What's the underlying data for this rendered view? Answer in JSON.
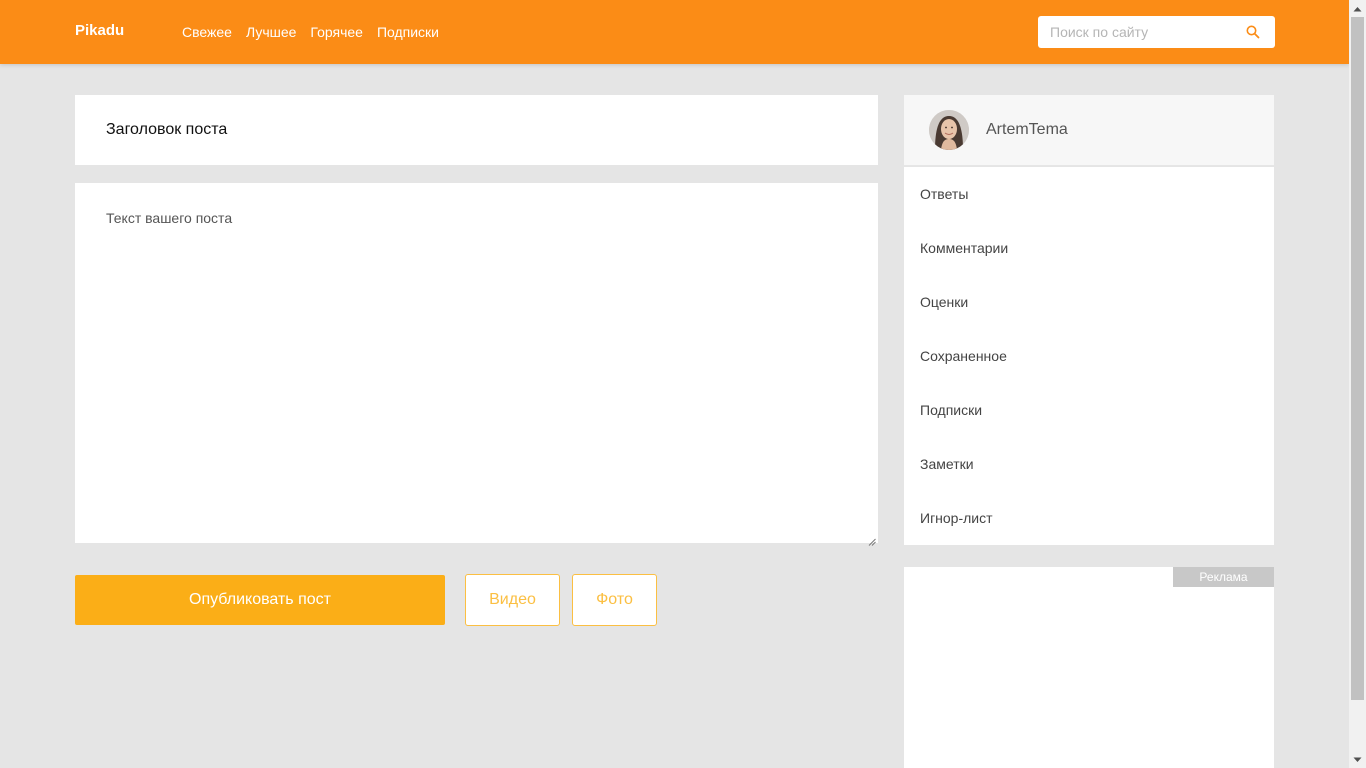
{
  "header": {
    "logo": "Pikadu",
    "nav": [
      "Свежее",
      "Лучшее",
      "Горячее",
      "Подписки"
    ],
    "search_placeholder": "Поиск по сайту",
    "background_color": "#fb8c16"
  },
  "editor": {
    "title_placeholder": "Заголовок поста",
    "text_placeholder": "Текст вашего поста",
    "publish_label": "Опубликовать пост",
    "video_label": "Видео",
    "photo_label": "Фото",
    "accent_color": "#fbae17"
  },
  "sidebar": {
    "username": "ArtemTema",
    "menu": [
      "Ответы",
      "Комментарии",
      "Оценки",
      "Сохраненное",
      "Подписки",
      "Заметки",
      "Игнор-лист"
    ],
    "ad_label": "Реклама"
  },
  "icons": {
    "search": "search-icon",
    "avatar": "user-avatar",
    "resize": "resize-grip-icon"
  }
}
